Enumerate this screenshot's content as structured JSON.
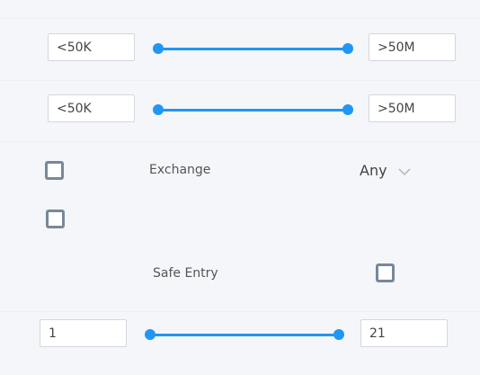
{
  "volume_filter": {
    "min": "<50K",
    "max": ">50M"
  },
  "market_cap_filter": {
    "min": "<50K",
    "max": ">50M"
  },
  "exchange": {
    "label": "Exchange",
    "value": "Any"
  },
  "safe_entry": {
    "label": "Safe Entry",
    "checked": false
  },
  "range_filter": {
    "min": "1",
    "max": "21"
  },
  "colors": {
    "accent": "#2196f3",
    "checkbox_border": "#778899"
  }
}
